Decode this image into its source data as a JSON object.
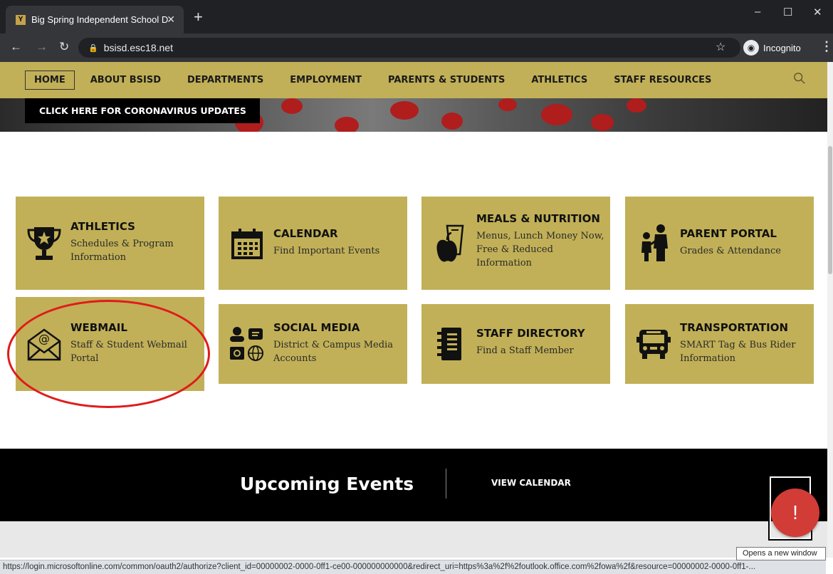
{
  "browser": {
    "tab_title": "Big Spring Independent School D",
    "tab_close": "✕",
    "new_tab": "+",
    "url": "bsisd.esc18.net",
    "mode_label": "Incognito",
    "window_controls": [
      "–",
      "☐",
      "✕"
    ]
  },
  "nav": {
    "items": [
      "HOME",
      "ABOUT BSISD",
      "DEPARTMENTS",
      "EMPLOYMENT",
      "PARENTS & STUDENTS",
      "ATHLETICS",
      "STAFF RESOURCES"
    ]
  },
  "hero": {
    "button_label": "CLICK HERE FOR CORONAVIRUS UPDATES"
  },
  "cards": [
    {
      "title": "ATHLETICS",
      "desc": "Schedules & Program Information",
      "icon": "trophy-icon"
    },
    {
      "title": "CALENDAR",
      "desc": "Find Important Events",
      "icon": "calendar-icon"
    },
    {
      "title": "MEALS & NUTRITION",
      "desc": "Menus, Lunch Money Now, Free & Reduced Information",
      "icon": "apple-bag-icon"
    },
    {
      "title": "PARENT PORTAL",
      "desc": "Grades & Attendance",
      "icon": "family-icon"
    },
    {
      "title": "WEBMAIL",
      "desc": "Staff & Student Webmail Portal",
      "icon": "envelope-at-icon"
    },
    {
      "title": "SOCIAL MEDIA",
      "desc": "District & Campus Media Accounts",
      "icon": "social-media-icon"
    },
    {
      "title": "STAFF DIRECTORY",
      "desc": "Find a Staff Member",
      "icon": "notebook-icon"
    },
    {
      "title": "TRANSPORTATION",
      "desc": "SMART Tag & Bus Rider Information",
      "icon": "bus-icon"
    }
  ],
  "events": {
    "heading": "Upcoming Events",
    "link": "VIEW CALENDAR"
  },
  "alert_label": "!",
  "status_url": "https://login.microsoftonline.com/common/oauth2/authorize?client_id=00000002-0000-0ff1-ce00-000000000000&redirect_uri=https%3a%2f%2foutlook.office.com%2fowa%2f&resource=00000002-0000-0ff1-...",
  "tooltip": "Opens a new window",
  "colors": {
    "gold": "#c1b057",
    "annotation": "#e01b1b",
    "alert": "#d13c36"
  }
}
